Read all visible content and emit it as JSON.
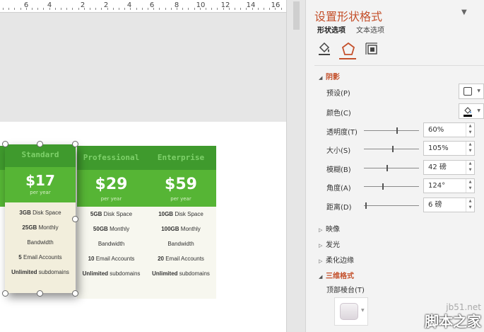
{
  "ruler": {
    "numbers": [
      "6",
      "4",
      "2",
      "2",
      "4",
      "6",
      "8",
      "10",
      "12",
      "14",
      "16"
    ]
  },
  "pricing": {
    "columns": [
      {
        "name": "Standard",
        "price": "$17",
        "period": "per year",
        "features": [
          [
            "3GB",
            "Disk Space"
          ],
          [
            "25GB",
            "Monthly"
          ],
          [
            "",
            "Bandwidth"
          ],
          [
            "5",
            "Email Accounts"
          ],
          [
            "Unlimited",
            "subdomains"
          ]
        ]
      },
      {
        "name": "Professional",
        "price": "$29",
        "period": "per year",
        "features": [
          [
            "5GB",
            "Disk Space"
          ],
          [
            "50GB",
            "Monthly"
          ],
          [
            "",
            "Bandwidth"
          ],
          [
            "10",
            "Email Accounts"
          ],
          [
            "Unlimited",
            "subdomains"
          ]
        ]
      },
      {
        "name": "Enterprise",
        "price": "$59",
        "period": "per year",
        "features": [
          [
            "10GB",
            "Disk Space"
          ],
          [
            "100GB",
            "Monthly"
          ],
          [
            "",
            "Bandwidth"
          ],
          [
            "20",
            "Email Accounts"
          ],
          [
            "Unlimited",
            "subdomains"
          ]
        ]
      }
    ]
  },
  "panel": {
    "title": "设置形状格式",
    "tabs": {
      "shape": "形状选项",
      "text": "文本选项"
    },
    "icons": [
      "fill-line-icon",
      "effects-icon",
      "size-properties-icon"
    ],
    "sections": {
      "shadow": "阴影",
      "reflection": "映像",
      "glow": "发光",
      "soft_edges": "柔化边缘",
      "three_d_format": "三维格式"
    },
    "shadow": {
      "preset_label": "预设(P)",
      "color_label": "颜色(C)",
      "transparency_label": "透明度(T)",
      "transparency_value": "60%",
      "transparency_level": 0.6,
      "size_label": "大小(S)",
      "size_value": "105%",
      "size_level": 0.52,
      "blur_label": "模糊(B)",
      "blur_value": "42 磅",
      "blur_level": 0.42,
      "angle_label": "角度(A)",
      "angle_value": "124°",
      "angle_level": 0.34,
      "distance_label": "距离(D)",
      "distance_value": "6 磅",
      "distance_level": 0.03
    },
    "three_d": {
      "top_bevel_label": "顶部棱台(T)"
    }
  },
  "colors": {
    "accent": "#c4502b",
    "header_green": "#3f9a2d",
    "price_green": "#56b535"
  },
  "watermark": {
    "site": "jb51.net",
    "brand": "脚本之家"
  }
}
